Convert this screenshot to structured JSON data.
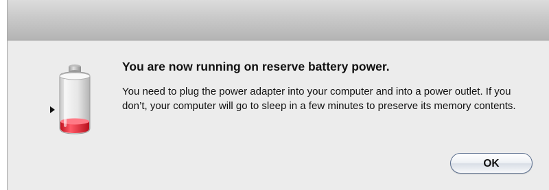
{
  "dialog": {
    "title": "You are now running on reserve battery power.",
    "message": "You need to plug the power adapter into your computer and into a power outlet. If you don’t, your computer will go to sleep in a few minutes to preserve its memory contents.",
    "ok_label": "OK"
  },
  "icons": {
    "battery": "battery-low-icon",
    "disclosure": "disclosure-triangle-icon"
  },
  "colors": {
    "battery_level": "#e8293a",
    "button_border": "#5a6e8e",
    "dialog_background": "#ececec"
  },
  "battery": {
    "charge_fraction": 0.12
  }
}
